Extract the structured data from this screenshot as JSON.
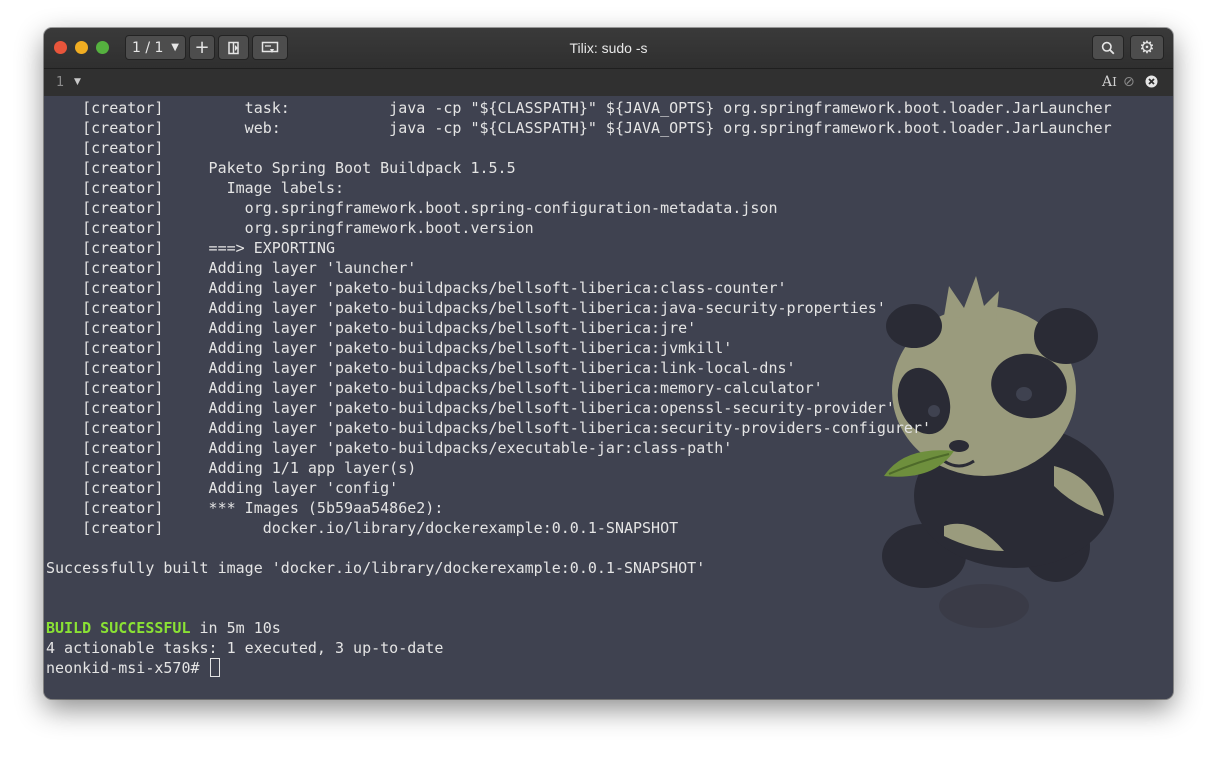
{
  "window": {
    "title": "Tilix: sudo -s",
    "session_label": "1 / 1",
    "terminal_number": "1",
    "icons": {
      "add": "plus-icon",
      "split": "split-terminal-icon",
      "sync": "synchronize-input-icon",
      "search": "search-icon",
      "settings": "gear-icon",
      "font": "text-size-icon",
      "readonly": "read-only-icon",
      "close": "close-icon"
    }
  },
  "terminal": {
    "lines": [
      "    [creator]         task:           java -cp \"${CLASSPATH}\" ${JAVA_OPTS} org.springframework.boot.loader.JarLauncher",
      "    [creator]         web:            java -cp \"${CLASSPATH}\" ${JAVA_OPTS} org.springframework.boot.loader.JarLauncher",
      "    [creator]",
      "    [creator]     Paketo Spring Boot Buildpack 1.5.5",
      "    [creator]       Image labels:",
      "    [creator]         org.springframework.boot.spring-configuration-metadata.json",
      "    [creator]         org.springframework.boot.version",
      "    [creator]     ===> EXPORTING",
      "    [creator]     Adding layer 'launcher'",
      "    [creator]     Adding layer 'paketo-buildpacks/bellsoft-liberica:class-counter'",
      "    [creator]     Adding layer 'paketo-buildpacks/bellsoft-liberica:java-security-properties'",
      "    [creator]     Adding layer 'paketo-buildpacks/bellsoft-liberica:jre'",
      "    [creator]     Adding layer 'paketo-buildpacks/bellsoft-liberica:jvmkill'",
      "    [creator]     Adding layer 'paketo-buildpacks/bellsoft-liberica:link-local-dns'",
      "    [creator]     Adding layer 'paketo-buildpacks/bellsoft-liberica:memory-calculator'",
      "    [creator]     Adding layer 'paketo-buildpacks/bellsoft-liberica:openssl-security-provider'",
      "    [creator]     Adding layer 'paketo-buildpacks/bellsoft-liberica:security-providers-configurer'",
      "    [creator]     Adding layer 'paketo-buildpacks/executable-jar:class-path'",
      "    [creator]     Adding 1/1 app layer(s)",
      "    [creator]     Adding layer 'config'",
      "    [creator]     *** Images (5b59aa5486e2):",
      "    [creator]           docker.io/library/dockerexample:0.0.1-SNAPSHOT",
      "",
      "Successfully built image 'docker.io/library/dockerexample:0.0.1-SNAPSHOT'",
      "",
      ""
    ],
    "build_status": "BUILD SUCCESSFUL",
    "build_time": " in 5m 10s",
    "tasks_summary": "4 actionable tasks: 1 executed, 3 up-to-date",
    "prompt": "neonkid-msi-x570# "
  },
  "colors": {
    "terminal_bg": "#3f4250",
    "foreground": "#e4e4e4",
    "success_green": "#8ae234",
    "titlebar": "#333333"
  }
}
